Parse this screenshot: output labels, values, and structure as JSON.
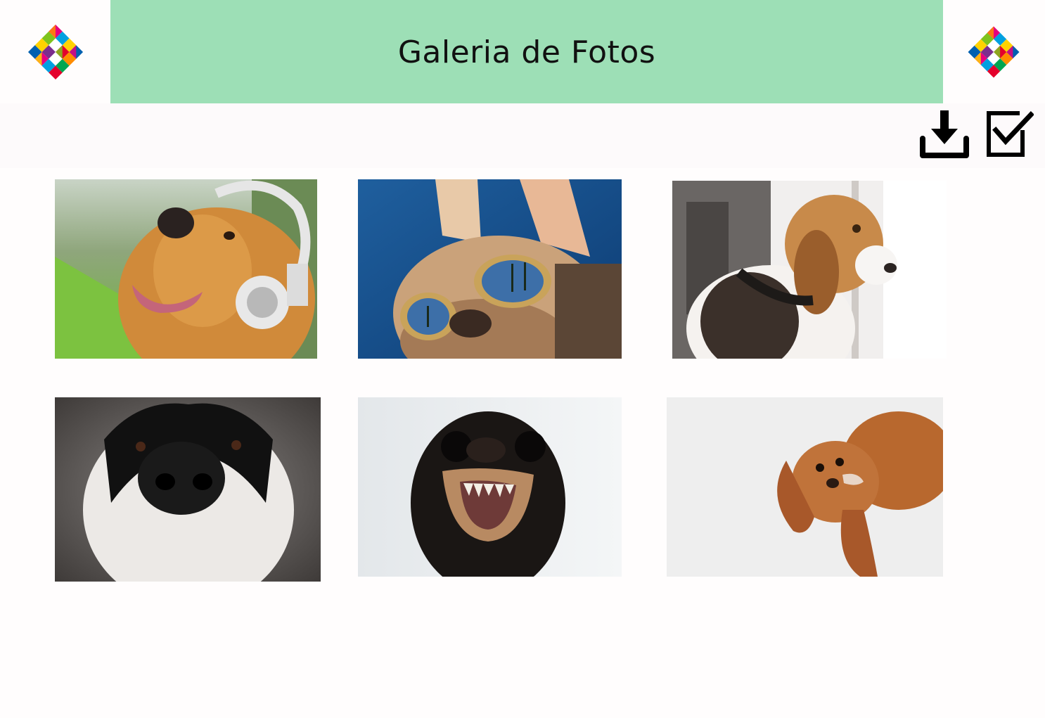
{
  "header": {
    "title": "Galeria de Fotos"
  },
  "logos": {
    "left_icon": "colorful-diamond-logo-icon",
    "right_icon": "colorful-diamond-logo-icon"
  },
  "toolbar": {
    "download_icon": "download-icon",
    "select_icon": "checkbox-checked-icon"
  },
  "gallery": {
    "photos": [
      {
        "subject": "golden retriever with headphones"
      },
      {
        "subject": "dog with aviator goggles"
      },
      {
        "subject": "beagle looking out window"
      },
      {
        "subject": "black and white dog nose close-up"
      },
      {
        "subject": "small black dog baring teeth"
      },
      {
        "subject": "brown spaniel puppy upside down"
      }
    ]
  },
  "colors": {
    "banner": "#9ddfb6",
    "background": "#fffdfd",
    "toolbar_strip": "#fdfafb",
    "icon": "#000000"
  }
}
